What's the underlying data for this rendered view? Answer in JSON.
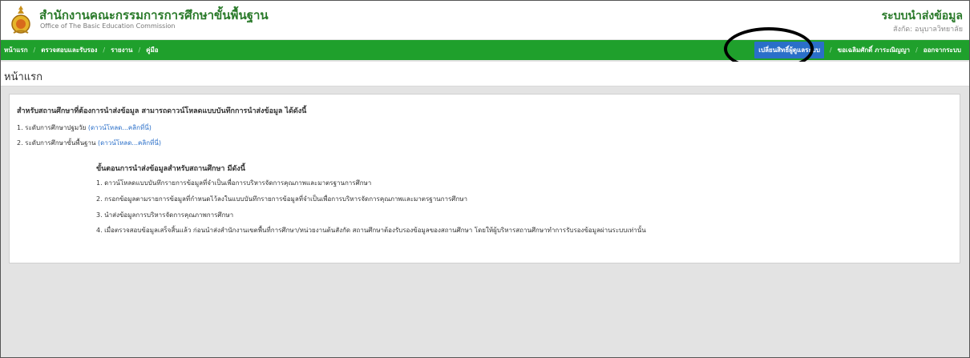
{
  "header": {
    "org_name_th": "สำนักงานคณะกรรมการการศึกษาขั้นพื้นฐาน",
    "org_name_en": "Office of The Basic Education Commission",
    "system_title": "ระบบนำส่งข้อมูล",
    "user_affiliation": "สังกัด: อนุบาลวิทยาลัย"
  },
  "nav": {
    "left_items": [
      "หน้าแรก",
      "ตรวจสอบและรับรอง",
      "รายงาน",
      "คู่มือ"
    ],
    "right_items": [
      "เปลี่ยนสิทธิ์ผู้ดูแลระบบ",
      "ขอเฉลิมศักดิ์ ภาระณิญญา",
      "ออกจากระบบ"
    ],
    "active_item": "เปลี่ยนสิทธิ์ผู้ดูแลระบบ"
  },
  "page": {
    "title": "หน้าแรก"
  },
  "content": {
    "intro": "สำหรับสถานศึกษาที่ต้องการนำส่งข้อมูล สามารถดาวน์โหลดแบบบันทึกการนำส่งข้อมูล ได้ดังนี้",
    "downloads": [
      {
        "label": "1. ระดับการศึกษาปฐมวัย",
        "link": "(ดาวน์โหลด...คลิกที่นี่)"
      },
      {
        "label": "2. ระดับการศึกษาขั้นพื้นฐาน",
        "link": "(ดาวน์โหลด...คลิกที่นี่)"
      }
    ],
    "steps_title": "ขั้นตอนการนำส่งข้อมูลสำหรับสถานศึกษา มีดังนี้",
    "steps": [
      "1. ดาวน์โหลดแบบบันทึกรายการข้อมูลที่จำเป็นเพื่อการบริหารจัดการคุณภาพและมาตรฐานการศึกษา",
      "2. กรอกข้อมูลตามรายการข้อมูลที่กำหนดไว้ลงในแบบบันทึกรายการข้อมูลที่จำเป็นเพื่อการบริหารจัดการคุณภาพและมาตรฐานการศึกษา",
      "3. นำส่งข้อมูลการบริหารจัดการคุณภาพการศึกษา",
      "4. เมื่อตรวจสอบข้อมูลเสร็จสิ้นแล้ว ก่อนนำส่งสำนักงานเขตพื้นที่การศึกษา/หน่วยงานต้นสังกัด สถานศึกษาต้องรับรองข้อมูลของสถานศึกษา โดยให้ผู้บริหารสถานศึกษาทำการรับรองข้อมูลผ่านระบบเท่านั้น"
    ]
  },
  "colors": {
    "nav_green": "#1fa02c",
    "brand_green": "#2a7a2a",
    "active_blue": "#2a6fc9",
    "background_gray": "#e3e3e3"
  }
}
